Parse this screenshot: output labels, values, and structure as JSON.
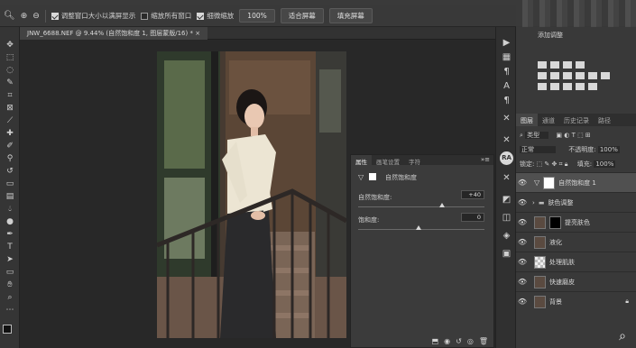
{
  "options_bar": {
    "resize_windows_label": "调整窗口大小以满屏显示",
    "zoom_all_windows_label": "缩放所有窗口",
    "scrubby_zoom_label": "细微缩放",
    "zoom_value": "100%",
    "fit_screen_label": "适合屏幕",
    "fill_screen_label": "填充屏幕"
  },
  "document_tab": {
    "title": "JNW_6688.NEF @ 9.44% (自然饱和度 1, 图层蒙版/16) *"
  },
  "adjustments_panel": {
    "title": "添加调整"
  },
  "layers_panel": {
    "tabs": [
      "图层",
      "通道",
      "历史记录",
      "路径"
    ],
    "filter_label": "类型",
    "blend_mode": "正常",
    "opacity_label": "不透明度:",
    "opacity_value": "100%",
    "lock_label": "锁定:",
    "fill_label": "填充:",
    "fill_value": "100%",
    "layers": [
      {
        "name": "自然饱和度 1",
        "type": "adjustment",
        "selected": true
      },
      {
        "name": "肤色调整",
        "type": "group"
      },
      {
        "name": "提亮肤色",
        "type": "pixel-mask"
      },
      {
        "name": "液化",
        "type": "pixel"
      },
      {
        "name": "处理肌肤",
        "type": "pixel"
      },
      {
        "name": "快速磨皮",
        "type": "pixel"
      },
      {
        "name": "背景",
        "type": "background"
      }
    ]
  },
  "properties_panel": {
    "tabs": [
      "属性",
      "画笔设置",
      "字符"
    ],
    "adjustment_name": "自然饱和度",
    "vibrance_label": "自然饱和度:",
    "vibrance_value": "+40",
    "saturation_label": "饱和度:",
    "saturation_value": "0"
  },
  "dock": {
    "ra_label": "RA"
  }
}
